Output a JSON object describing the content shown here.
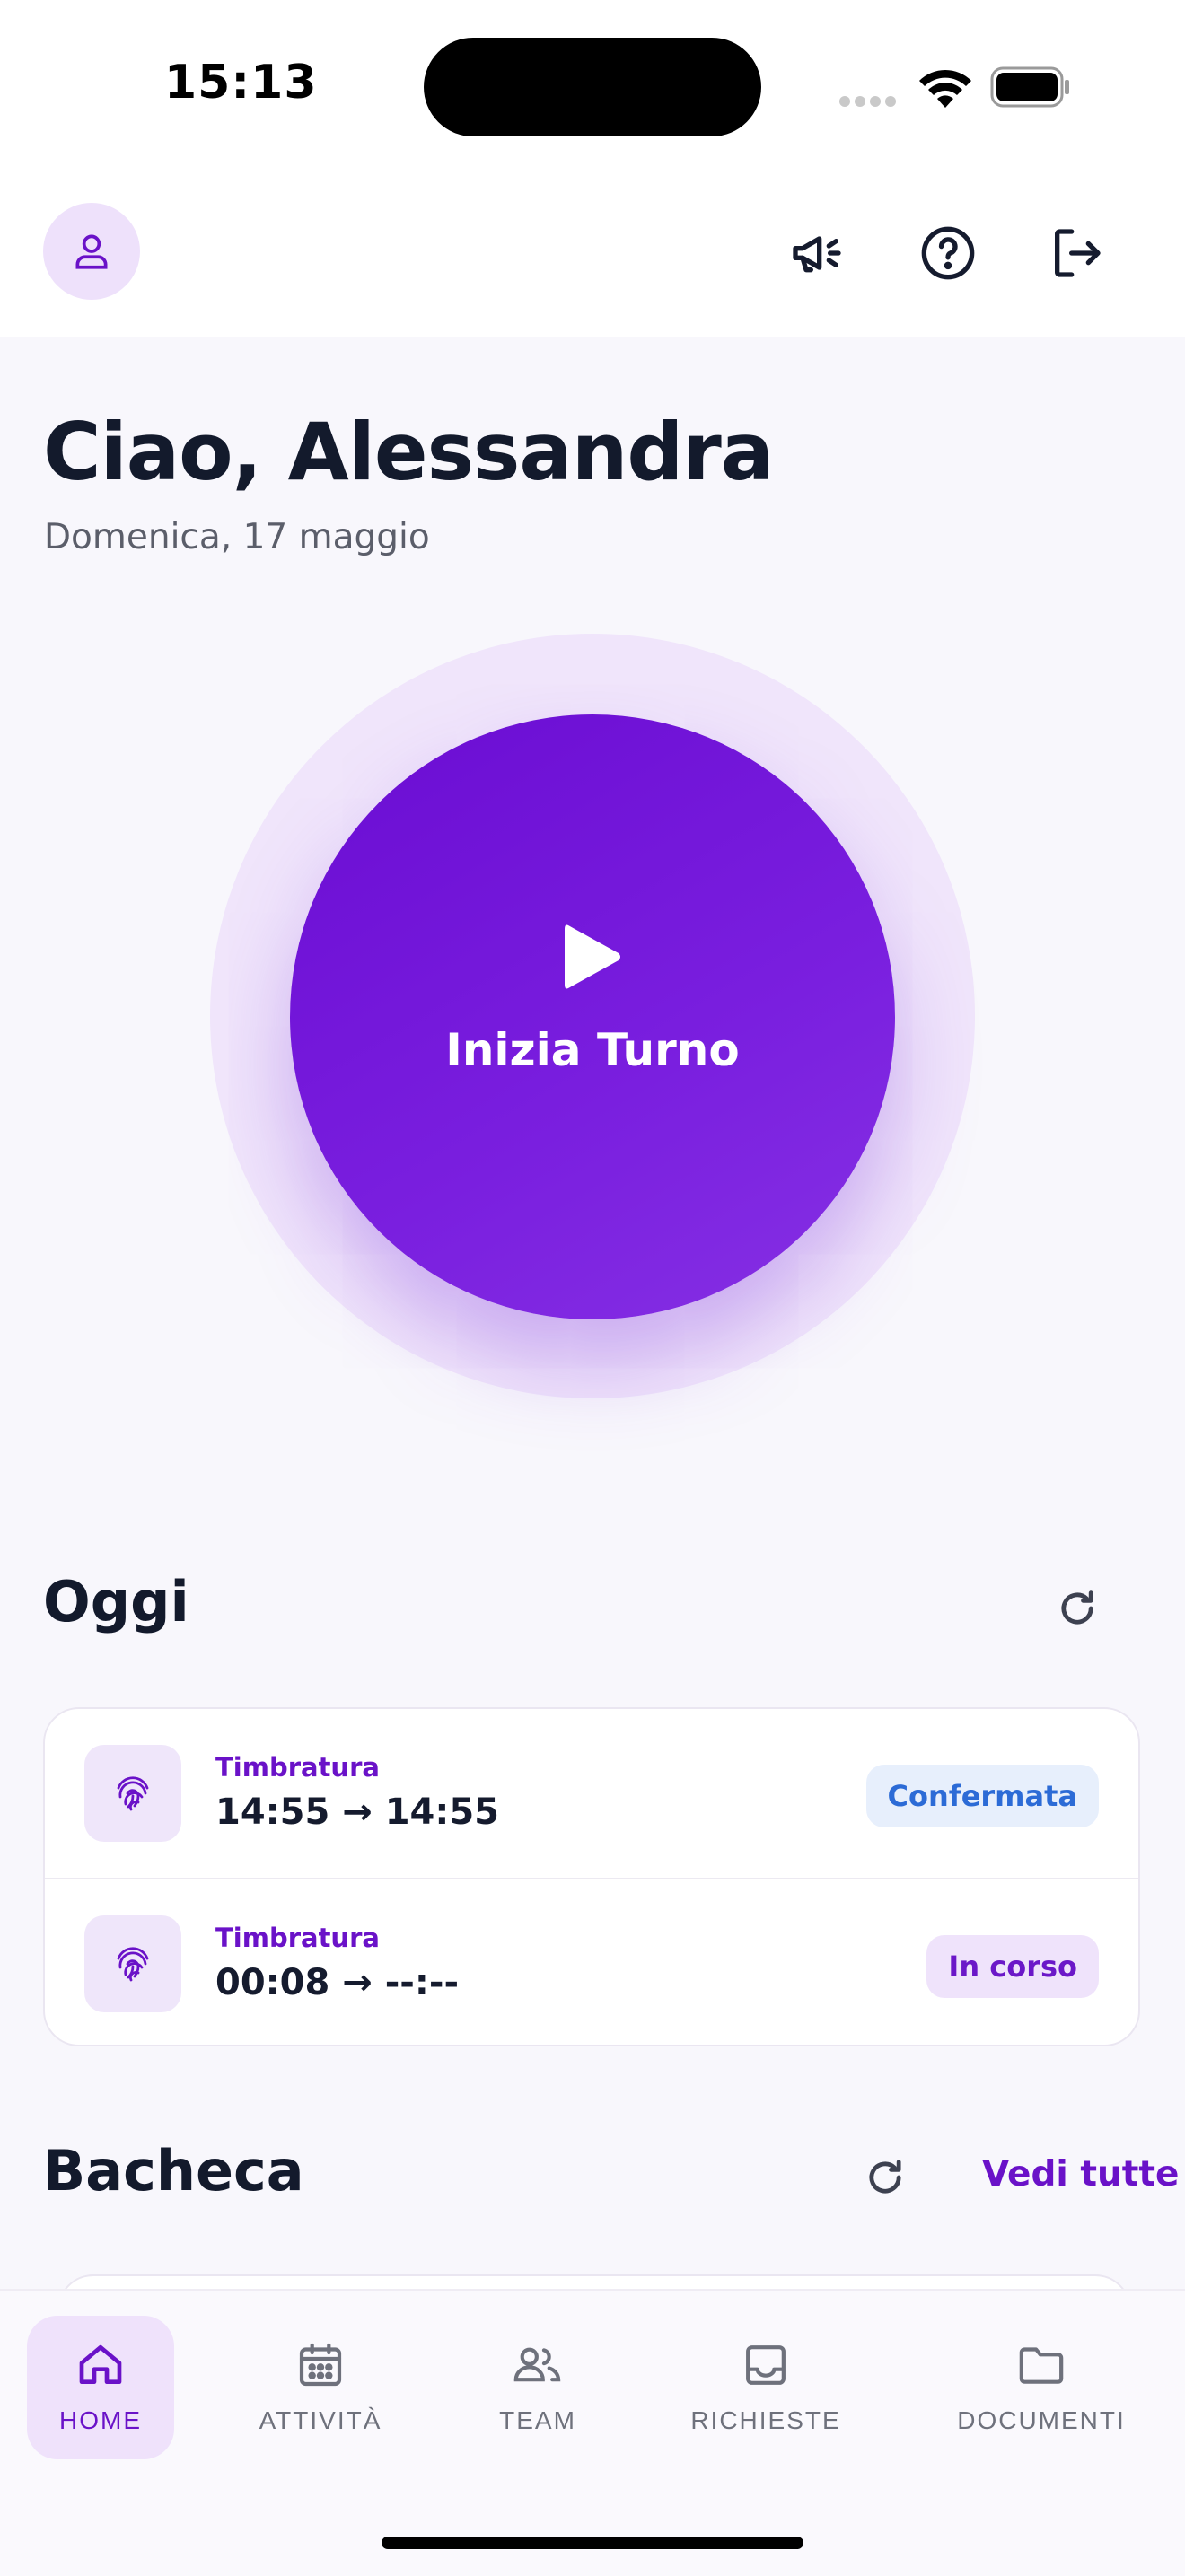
{
  "status_bar": {
    "time": "15:13"
  },
  "header": {
    "greeting": "Ciao, Alessandra",
    "date": "Domenica, 17 maggio"
  },
  "shift_button": {
    "label": "Inizia Turno"
  },
  "today": {
    "title": "Oggi",
    "entries": [
      {
        "kind": "Timbratura",
        "range": "14:55 → 14:55",
        "status": "Confermata"
      },
      {
        "kind": "Timbratura",
        "range": "00:08 → --:--",
        "status": "In corso"
      }
    ]
  },
  "board": {
    "title": "Bacheca",
    "see_all": "Vedi tutte"
  },
  "nav": {
    "items": [
      {
        "label": "HOME",
        "icon": "home-icon",
        "active": true
      },
      {
        "label": "ATTIVITÀ",
        "icon": "calendar-icon",
        "active": false
      },
      {
        "label": "TEAM",
        "icon": "team-icon",
        "active": false
      },
      {
        "label": "RICHIESTE",
        "icon": "inbox-icon",
        "active": false
      },
      {
        "label": "DOCUMENTI",
        "icon": "folder-icon",
        "active": false
      }
    ]
  },
  "colors": {
    "accent": "#6a12c8",
    "accent_light": "#efe2fb",
    "confirmed_badge_text": "#2c6bd6",
    "confirmed_badge_bg": "#e7effc"
  }
}
